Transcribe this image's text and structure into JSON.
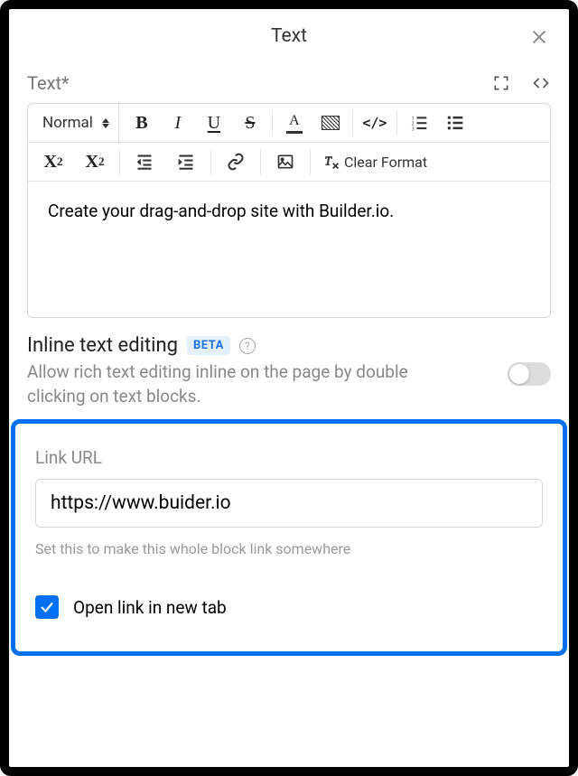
{
  "header": {
    "title": "Text"
  },
  "field": {
    "label": "Text*"
  },
  "toolbar": {
    "format_select": "Normal",
    "clear_format": "Clear Format"
  },
  "editor": {
    "content": "Create your drag-and-drop site with Builder.io."
  },
  "inline": {
    "title": "Inline text editing",
    "badge": "BETA",
    "description": "Allow rich text editing inline on the page by double clicking on text blocks.",
    "toggle": false
  },
  "link": {
    "label": "Link URL",
    "value": "https://www.buider.io",
    "help": "Set this to make this whole block link somewhere",
    "newtab_label": "Open link in new tab",
    "newtab_checked": true
  }
}
